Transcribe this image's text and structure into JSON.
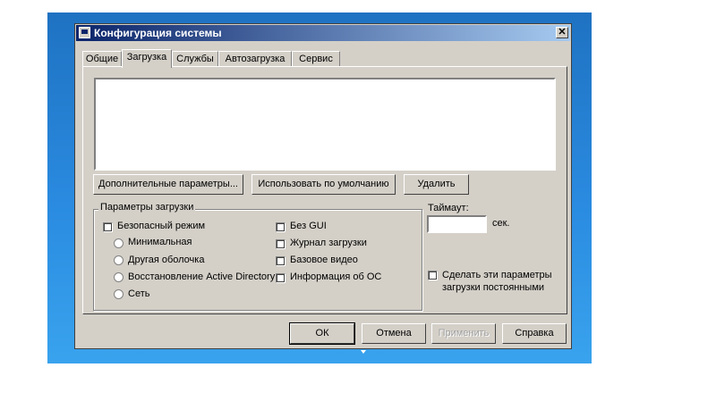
{
  "window": {
    "title": "Конфигурация системы"
  },
  "tabs": [
    {
      "label": "Общие"
    },
    {
      "label": "Загрузка"
    },
    {
      "label": "Службы"
    },
    {
      "label": "Автозагрузка"
    },
    {
      "label": "Сервис"
    }
  ],
  "active_tab": "Загрузка",
  "boot_buttons": {
    "advanced": "Дополнительные параметры...",
    "set_default": "Использовать по умолчанию",
    "delete": "Удалить"
  },
  "boot_options": {
    "title": "Параметры загрузки",
    "safe_boot": {
      "label": "Безопасный режим",
      "checked": false
    },
    "radios": [
      {
        "label": "Минимальная"
      },
      {
        "label": "Другая оболочка"
      },
      {
        "label": "Восстановление Active Directory"
      },
      {
        "label": "Сеть"
      }
    ],
    "right_checks": [
      {
        "label": "Без GUI",
        "checked": false
      },
      {
        "label": "Журнал загрузки",
        "checked": false
      },
      {
        "label": "Базовое видео",
        "checked": false
      },
      {
        "label": "Информация  об ОС",
        "checked": false
      }
    ]
  },
  "timeout": {
    "label": "Таймаут:",
    "value": "",
    "unit": "сек."
  },
  "persist": {
    "label_line1": "Сделать эти параметры",
    "label_line2": "загрузки постоянными",
    "checked": false
  },
  "dialog_buttons": {
    "ok": "ОК",
    "cancel": "Отмена",
    "apply": "Применить",
    "help": "Справка"
  },
  "colors": {
    "face": "#d4d0c8",
    "title_start": "#0a246a",
    "title_end": "#a6caf0",
    "desktop": "#2a8be0"
  },
  "icons": {
    "app": "msconfig-icon",
    "close": "close-icon"
  }
}
